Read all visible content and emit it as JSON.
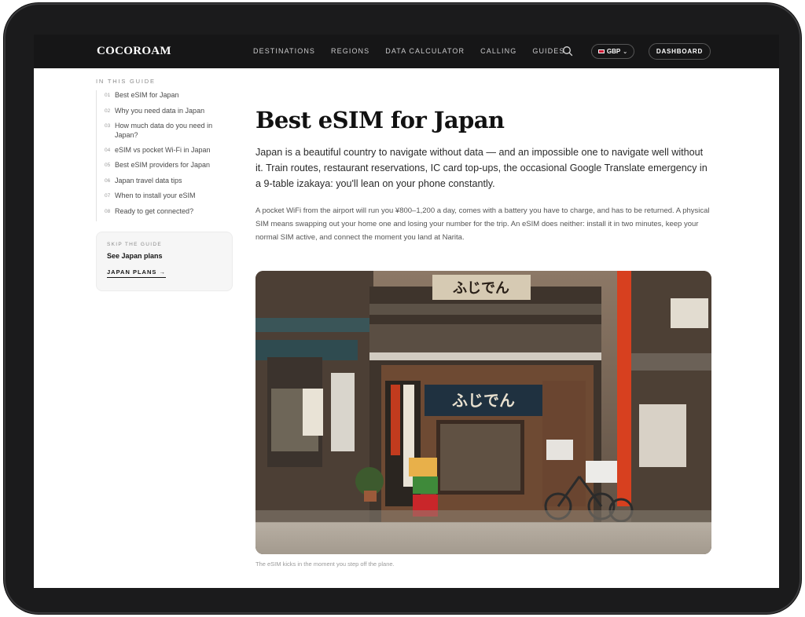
{
  "brand": {
    "logo": "COCOROAM"
  },
  "nav": {
    "items": [
      "DESTINATIONS",
      "REGIONS",
      "DATA CALCULATOR",
      "CALLING",
      "GUIDES"
    ],
    "currency": "GBP",
    "dashboard": "DASHBOARD"
  },
  "toc": {
    "heading": "IN THIS GUIDE",
    "items": [
      {
        "num": "01",
        "label": "Best eSIM for Japan"
      },
      {
        "num": "02",
        "label": "Why you need data in Japan"
      },
      {
        "num": "03",
        "label": "How much data do you need in Japan?"
      },
      {
        "num": "04",
        "label": "eSIM vs pocket Wi-Fi in Japan"
      },
      {
        "num": "05",
        "label": "Best eSIM providers for Japan"
      },
      {
        "num": "06",
        "label": "Japan travel data tips"
      },
      {
        "num": "07",
        "label": "When to install your eSIM"
      },
      {
        "num": "08",
        "label": "Ready to get connected?"
      }
    ]
  },
  "skip": {
    "eyebrow": "SKIP THE GUIDE",
    "title": "See Japan plans",
    "link": "JAPAN PLANS →"
  },
  "article": {
    "title": "Best eSIM for Japan",
    "lede": "Japan is a beautiful country to navigate without data — and an impossible one to navigate well without it. Train routes, restaurant reservations, IC card top-ups, the occasional Google Translate emergency in a 9-table izakaya: you'll lean on your phone constantly.",
    "body": "A pocket WiFi from the airport will run you ¥800–1,200 a day, comes with a battery you have to charge, and has to be returned. A physical SIM means swapping out your home one and losing your number for the trip. An eSIM does neither: install it in two minutes, keep your normal SIM active, and connect the moment you land at Narita.",
    "photo_sign": "ふじでん",
    "caption": "The eSIM kicks in the moment you step off the plane."
  },
  "colors": {
    "nav_bg": "#161617",
    "accent_red": "#d7401f",
    "shop_curtain": "#1f3140"
  }
}
